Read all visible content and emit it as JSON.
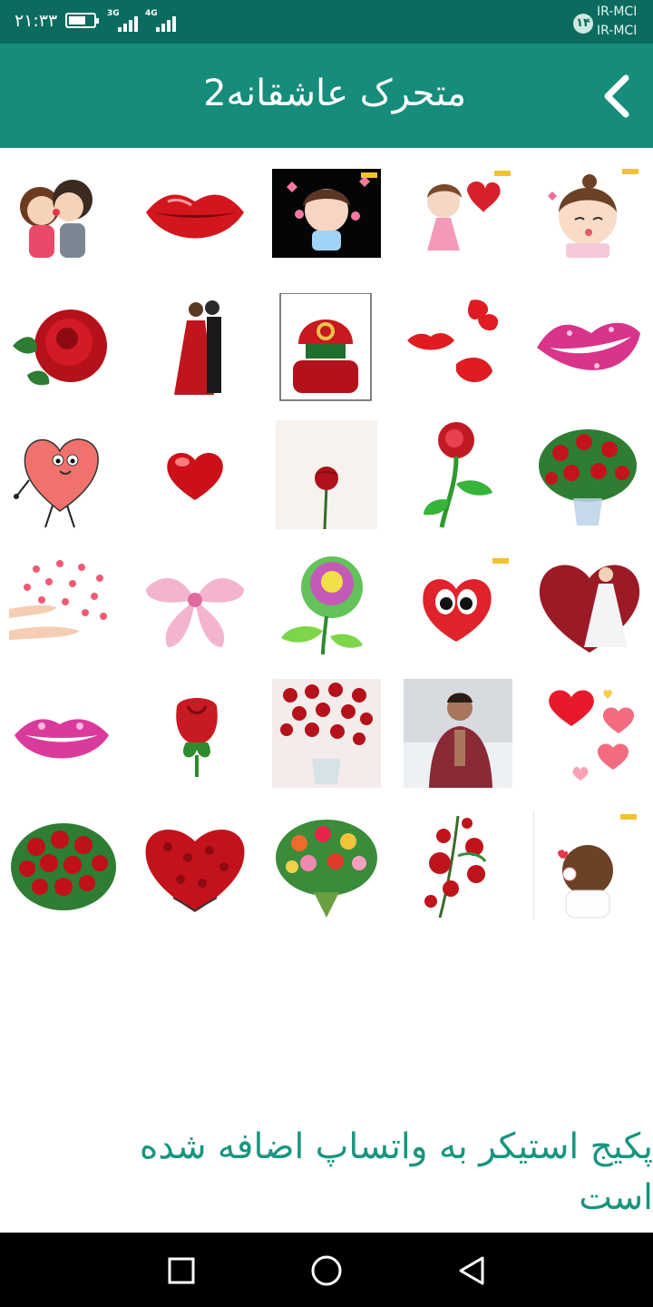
{
  "status_bar": {
    "time": "۲۱:۳۳",
    "battery_level_percent": 70,
    "network_1": "3G",
    "network_2": "4G",
    "carrier_badge": "۱۴",
    "carrier_1": "IR-MCI",
    "carrier_2": "IR-MCI"
  },
  "header": {
    "title": "متحرک عاشقانه2",
    "back_icon": "chevron-left-icon"
  },
  "stickers": [
    {
      "name": "kissing-couple"
    },
    {
      "name": "red-lips"
    },
    {
      "name": "girl-with-hearts"
    },
    {
      "name": "girl-with-heart-balloon"
    },
    {
      "name": "girl-blowing-kiss"
    },
    {
      "name": "red-rose"
    },
    {
      "name": "dancing-couple"
    },
    {
      "name": "ring-box"
    },
    {
      "name": "lips-and-bow"
    },
    {
      "name": "glitter-pink-lips"
    },
    {
      "name": "heart-character"
    },
    {
      "name": "red-3d-heart"
    },
    {
      "name": "single-rose-photo"
    },
    {
      "name": "glitter-rose"
    },
    {
      "name": "rose-vase"
    },
    {
      "name": "hands-with-hearts"
    },
    {
      "name": "pink-glitter-bow"
    },
    {
      "name": "rainbow-rose"
    },
    {
      "name": "heart-face"
    },
    {
      "name": "bride-glitter-heart"
    },
    {
      "name": "pink-glitter-lips"
    },
    {
      "name": "rose-bud"
    },
    {
      "name": "rose-bouquet-vase"
    },
    {
      "name": "man-in-snow-photo"
    },
    {
      "name": "floating-hearts"
    },
    {
      "name": "red-rose-bouquet"
    },
    {
      "name": "rose-heart"
    },
    {
      "name": "mixed-flower-bouquet"
    },
    {
      "name": "red-roses-branch"
    },
    {
      "name": "shy-girl"
    }
  ],
  "footer": {
    "added_message": "پکیج استیکر به واتساپ اضافه شده است"
  },
  "nav_bar": {
    "recents_icon": "square-icon",
    "home_icon": "circle-icon",
    "back_icon": "triangle-back-icon"
  },
  "colors": {
    "status_bar": "#0b6b5e",
    "app_bar": "#168c7a",
    "accent_text": "#18957f",
    "nav_bar": "#000000"
  }
}
